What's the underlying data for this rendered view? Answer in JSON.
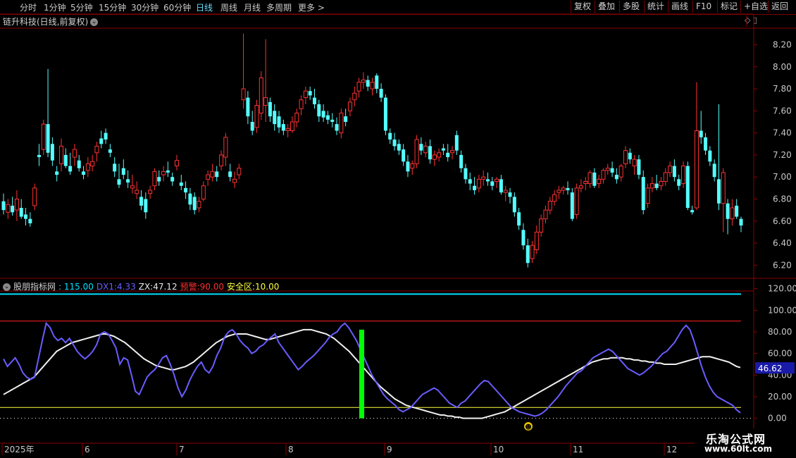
{
  "toolbar": {
    "timeframes": [
      "分时",
      "1分钟",
      "5分钟",
      "15分钟",
      "30分钟",
      "60分钟",
      "日线",
      "周线",
      "月线",
      "多周期",
      "更多 >"
    ],
    "active": "日线",
    "right_buttons": [
      "复权",
      "叠加",
      "多股",
      "统计",
      "画线",
      "F10",
      "标记",
      "+自选",
      "返回"
    ]
  },
  "stock": {
    "title": "链升科技(日线,前复权)"
  },
  "price_axis": {
    "labels": [
      "8.20",
      "8.00",
      "7.80",
      "7.60",
      "7.40",
      "7.20",
      "7.00",
      "6.80",
      "6.60",
      "6.40",
      "6.20"
    ],
    "values": [
      8.2,
      8.0,
      7.8,
      7.6,
      7.4,
      7.2,
      7.0,
      6.8,
      6.6,
      6.4,
      6.2
    ]
  },
  "indicator": {
    "name": "股朋指标网",
    "fields": [
      {
        "label": "",
        "value": ": 115.00",
        "color": "#00e0ff"
      },
      {
        "label": "DX1:",
        "value": "4.33",
        "color": "#6a5cff"
      },
      {
        "label": "ZX:",
        "value": "47.12",
        "color": "#e8e8e8"
      },
      {
        "label": "预警:",
        "value": "90.00",
        "color": "#ff3030"
      },
      {
        "label": "安全区:",
        "value": "10.00",
        "color": "#ffff40"
      }
    ],
    "axis_labels": [
      "120.00",
      "100.00",
      "80.00",
      "60.00",
      "40.00",
      "20.00",
      "0.00"
    ],
    "axis_values": [
      120,
      100,
      80,
      60,
      40,
      20,
      0
    ],
    "current_value": "46.62",
    "lines": {
      "top": 115,
      "warn": 90,
      "safe": 10
    },
    "colors": {
      "top": "#00e0ff",
      "warn": "#ff2020",
      "safe": "#ffff40",
      "dx1": "#6a5cff",
      "zx": "#f0f0f0",
      "signal": "#00ff00"
    }
  },
  "time_axis": {
    "labels": [
      "2025年",
      "6",
      "7",
      "8",
      "9",
      "10",
      "11",
      "12"
    ]
  },
  "watermark": {
    "line1": "乐淘公式网",
    "line2": "www.60lt.com"
  },
  "chart_data": {
    "type": "candlestick",
    "ylim": [
      6.1,
      8.35
    ],
    "candles": [
      [
        6.78,
        6.85,
        6.66,
        6.7
      ],
      [
        6.68,
        6.8,
        6.62,
        6.75
      ],
      [
        6.74,
        6.82,
        6.65,
        6.68
      ],
      [
        6.7,
        6.88,
        6.6,
        6.8
      ],
      [
        6.72,
        6.8,
        6.62,
        6.64
      ],
      [
        6.66,
        6.72,
        6.56,
        6.62
      ],
      [
        6.62,
        6.68,
        6.55,
        6.58
      ],
      [
        6.74,
        6.94,
        6.7,
        6.9
      ],
      [
        7.2,
        7.3,
        7.1,
        7.18
      ],
      [
        7.25,
        7.52,
        7.2,
        7.48
      ],
      [
        7.48,
        7.98,
        7.18,
        7.22
      ],
      [
        7.3,
        7.36,
        7.1,
        7.15
      ],
      [
        7.05,
        7.1,
        6.96,
        7.02
      ],
      [
        7.12,
        7.35,
        7.05,
        7.28
      ],
      [
        7.2,
        7.26,
        7.08,
        7.1
      ],
      [
        7.1,
        7.22,
        7.02,
        7.05
      ],
      [
        7.18,
        7.3,
        7.1,
        7.25
      ],
      [
        7.15,
        7.2,
        7.05,
        7.08
      ],
      [
        7.05,
        7.1,
        6.98,
        7.02
      ],
      [
        7.06,
        7.18,
        7.0,
        7.12
      ],
      [
        7.1,
        7.2,
        7.05,
        7.14
      ],
      [
        7.22,
        7.32,
        7.14,
        7.28
      ],
      [
        7.35,
        7.42,
        7.26,
        7.3
      ],
      [
        7.4,
        7.44,
        7.3,
        7.34
      ],
      [
        7.25,
        7.3,
        7.18,
        7.22
      ],
      [
        7.12,
        7.18,
        7.0,
        7.05
      ],
      [
        6.98,
        7.12,
        6.9,
        6.93
      ],
      [
        7.08,
        7.16,
        6.98,
        7.02
      ],
      [
        6.98,
        7.06,
        6.9,
        6.95
      ],
      [
        6.9,
        7.02,
        6.85,
        6.92
      ],
      [
        6.85,
        6.96,
        6.8,
        6.88
      ],
      [
        6.82,
        6.88,
        6.7,
        6.74
      ],
      [
        6.8,
        6.86,
        6.62,
        6.68
      ],
      [
        6.85,
        6.92,
        6.8,
        6.88
      ],
      [
        6.92,
        7.08,
        6.88,
        7.05
      ],
      [
        7.0,
        7.06,
        6.92,
        6.96
      ],
      [
        7.02,
        7.1,
        6.96,
        7.05
      ],
      [
        7.06,
        7.14,
        7.0,
        7.04
      ],
      [
        7.0,
        7.04,
        6.92,
        6.96
      ],
      [
        7.1,
        7.2,
        7.06,
        7.15
      ],
      [
        6.95,
        7.02,
        6.88,
        6.92
      ],
      [
        6.9,
        6.96,
        6.8,
        6.86
      ],
      [
        6.85,
        6.9,
        6.7,
        6.75
      ],
      [
        6.82,
        6.86,
        6.66,
        6.7
      ],
      [
        6.72,
        6.82,
        6.68,
        6.78
      ],
      [
        6.8,
        6.96,
        6.78,
        6.92
      ],
      [
        6.98,
        7.06,
        6.92,
        7.02
      ],
      [
        7.0,
        7.12,
        6.96,
        7.05
      ],
      [
        7.05,
        7.1,
        6.96,
        7.0
      ],
      [
        7.1,
        7.24,
        7.06,
        7.2
      ],
      [
        7.18,
        7.4,
        7.1,
        7.36
      ],
      [
        7.05,
        7.12,
        6.96,
        7.0
      ],
      [
        6.95,
        7.05,
        6.9,
        6.98
      ],
      [
        7.02,
        7.12,
        6.98,
        7.08
      ],
      [
        7.7,
        8.3,
        7.62,
        7.8
      ],
      [
        7.72,
        7.78,
        7.48,
        7.55
      ],
      [
        7.5,
        7.6,
        7.38,
        7.42
      ],
      [
        7.45,
        7.7,
        7.4,
        7.65
      ],
      [
        7.58,
        7.96,
        7.52,
        7.9
      ],
      [
        7.65,
        8.25,
        7.5,
        7.72
      ],
      [
        7.68,
        7.72,
        7.5,
        7.55
      ],
      [
        7.6,
        7.66,
        7.42,
        7.48
      ],
      [
        7.55,
        7.6,
        7.4,
        7.45
      ],
      [
        7.48,
        7.52,
        7.38,
        7.42
      ],
      [
        7.42,
        7.48,
        7.36,
        7.44
      ],
      [
        7.42,
        7.55,
        7.4,
        7.5
      ],
      [
        7.5,
        7.62,
        7.45,
        7.58
      ],
      [
        7.62,
        7.74,
        7.56,
        7.7
      ],
      [
        7.72,
        7.82,
        7.66,
        7.78
      ],
      [
        7.78,
        7.82,
        7.7,
        7.74
      ],
      [
        7.72,
        7.8,
        7.62,
        7.66
      ],
      [
        7.66,
        7.7,
        7.5,
        7.55
      ],
      [
        7.6,
        7.66,
        7.5,
        7.54
      ],
      [
        7.56,
        7.6,
        7.48,
        7.52
      ],
      [
        7.52,
        7.58,
        7.45,
        7.5
      ],
      [
        7.48,
        7.54,
        7.38,
        7.42
      ],
      [
        7.4,
        7.62,
        7.35,
        7.58
      ],
      [
        7.55,
        7.62,
        7.46,
        7.5
      ],
      [
        7.6,
        7.72,
        7.55,
        7.68
      ],
      [
        7.7,
        7.82,
        7.64,
        7.76
      ],
      [
        7.78,
        7.9,
        7.72,
        7.86
      ],
      [
        7.86,
        7.95,
        7.8,
        7.88
      ],
      [
        7.88,
        7.92,
        7.78,
        7.82
      ],
      [
        7.8,
        7.9,
        7.74,
        7.86
      ],
      [
        7.92,
        7.94,
        7.76,
        7.8
      ],
      [
        7.8,
        7.85,
        7.68,
        7.72
      ],
      [
        7.72,
        7.75,
        7.38,
        7.42
      ],
      [
        7.4,
        7.44,
        7.3,
        7.34
      ],
      [
        7.34,
        7.4,
        7.24,
        7.28
      ],
      [
        7.3,
        7.34,
        7.2,
        7.24
      ],
      [
        7.25,
        7.3,
        7.1,
        7.14
      ],
      [
        7.14,
        7.2,
        7.0,
        7.05
      ],
      [
        7.08,
        7.15,
        7.02,
        7.12
      ],
      [
        7.12,
        7.38,
        7.08,
        7.34
      ],
      [
        7.3,
        7.36,
        7.2,
        7.24
      ],
      [
        7.22,
        7.32,
        7.18,
        7.28
      ],
      [
        7.28,
        7.34,
        7.12,
        7.16
      ],
      [
        7.16,
        7.24,
        7.1,
        7.2
      ],
      [
        7.18,
        7.26,
        7.14,
        7.22
      ],
      [
        7.26,
        7.3,
        7.2,
        7.24
      ],
      [
        7.22,
        7.3,
        7.14,
        7.18
      ],
      [
        7.22,
        7.28,
        7.16,
        7.24
      ],
      [
        7.38,
        7.42,
        7.2,
        7.24
      ],
      [
        7.2,
        7.24,
        7.04,
        7.08
      ],
      [
        7.08,
        7.12,
        6.94,
        6.98
      ],
      [
        6.98,
        7.04,
        6.88,
        6.94
      ],
      [
        6.92,
        7.0,
        6.84,
        6.88
      ],
      [
        6.9,
        7.02,
        6.86,
        6.98
      ],
      [
        6.98,
        7.06,
        6.92,
        7.0
      ],
      [
        6.98,
        7.04,
        6.92,
        6.96
      ],
      [
        6.96,
        7.0,
        6.88,
        6.92
      ],
      [
        6.96,
        7.0,
        6.9,
        6.98
      ],
      [
        6.98,
        7.02,
        6.84,
        6.86
      ],
      [
        6.86,
        6.92,
        6.78,
        6.88
      ],
      [
        6.86,
        6.9,
        6.76,
        6.82
      ],
      [
        6.82,
        6.86,
        6.64,
        6.68
      ],
      [
        6.68,
        6.72,
        6.52,
        6.56
      ],
      [
        6.52,
        6.58,
        6.34,
        6.38
      ],
      [
        6.38,
        6.44,
        6.18,
        6.22
      ],
      [
        6.26,
        6.42,
        6.22,
        6.38
      ],
      [
        6.34,
        6.56,
        6.3,
        6.5
      ],
      [
        6.5,
        6.66,
        6.46,
        6.62
      ],
      [
        6.62,
        6.74,
        6.58,
        6.7
      ],
      [
        6.7,
        6.82,
        6.66,
        6.78
      ],
      [
        6.78,
        6.88,
        6.74,
        6.84
      ],
      [
        6.86,
        6.92,
        6.8,
        6.88
      ],
      [
        6.88,
        6.92,
        6.84,
        6.9
      ],
      [
        6.9,
        6.96,
        6.84,
        6.88
      ],
      [
        6.86,
        6.9,
        6.6,
        6.62
      ],
      [
        6.66,
        6.94,
        6.62,
        6.9
      ],
      [
        6.9,
        6.98,
        6.86,
        6.92
      ],
      [
        6.94,
        7.0,
        6.88,
        6.96
      ],
      [
        6.94,
        7.06,
        6.9,
        7.04
      ],
      [
        7.04,
        7.08,
        6.9,
        6.92
      ],
      [
        6.94,
        7.02,
        6.9,
        6.98
      ],
      [
        6.98,
        7.08,
        6.94,
        7.06
      ],
      [
        7.06,
        7.12,
        7.02,
        7.08
      ],
      [
        7.08,
        7.14,
        7.0,
        7.04
      ],
      [
        7.02,
        7.08,
        6.94,
        6.98
      ],
      [
        7.0,
        7.12,
        6.96,
        7.1
      ],
      [
        7.12,
        7.28,
        7.08,
        7.24
      ],
      [
        7.22,
        7.26,
        7.12,
        7.16
      ],
      [
        7.1,
        7.2,
        7.02,
        7.16
      ],
      [
        7.16,
        7.2,
        6.98,
        7.02
      ],
      [
        7.0,
        7.06,
        6.66,
        6.7
      ],
      [
        6.76,
        6.94,
        6.72,
        6.9
      ],
      [
        6.9,
        7.0,
        6.86,
        6.94
      ],
      [
        6.94,
        7.02,
        6.88,
        6.9
      ],
      [
        6.92,
        7.0,
        6.88,
        6.96
      ],
      [
        6.96,
        7.08,
        6.92,
        7.04
      ],
      [
        7.04,
        7.14,
        7.0,
        7.1
      ],
      [
        7.1,
        7.16,
        6.96,
        7.0
      ],
      [
        6.98,
        7.02,
        6.88,
        6.92
      ],
      [
        6.94,
        7.14,
        6.9,
        7.1
      ],
      [
        7.1,
        7.14,
        6.7,
        6.72
      ],
      [
        6.7,
        6.74,
        6.66,
        6.68
      ],
      [
        6.72,
        7.86,
        6.7,
        7.42
      ],
      [
        7.42,
        7.6,
        7.3,
        7.36
      ],
      [
        7.36,
        7.4,
        7.2,
        7.24
      ],
      [
        7.24,
        7.28,
        7.1,
        7.14
      ],
      [
        7.12,
        7.16,
        6.96,
        7.0
      ],
      [
        6.98,
        7.66,
        6.7,
        6.76
      ],
      [
        6.76,
        7.08,
        6.5,
        7.04
      ],
      [
        6.76,
        6.8,
        6.48,
        6.62
      ],
      [
        6.62,
        6.8,
        6.56,
        6.72
      ],
      [
        6.74,
        6.8,
        6.62,
        6.64
      ],
      [
        6.62,
        6.64,
        6.5,
        6.56
      ]
    ],
    "dx1": [
      55,
      48,
      52,
      56,
      50,
      42,
      38,
      36,
      38,
      55,
      72,
      88,
      84,
      76,
      72,
      74,
      70,
      74,
      68,
      62,
      58,
      55,
      58,
      62,
      68,
      78,
      80,
      78,
      72,
      65,
      50,
      56,
      54,
      40,
      25,
      22,
      30,
      38,
      42,
      45,
      50,
      56,
      58,
      50,
      40,
      28,
      20,
      26,
      35,
      42,
      48,
      52,
      45,
      42,
      48,
      58,
      65,
      75,
      80,
      82,
      78,
      72,
      68,
      65,
      60,
      62,
      66,
      68,
      72,
      75,
      78,
      70,
      65,
      60,
      55,
      50,
      45,
      48,
      52,
      55,
      58,
      62,
      66,
      70,
      75,
      78,
      80,
      85,
      88,
      84,
      78,
      72,
      64,
      56,
      48,
      40,
      34,
      28,
      22,
      18,
      15,
      12,
      8,
      6,
      8,
      10,
      14,
      18,
      22,
      24,
      26,
      28,
      26,
      22,
      18,
      14,
      12,
      10,
      14,
      16,
      20,
      24,
      28,
      32,
      35,
      34,
      30,
      26,
      22,
      18,
      14,
      10,
      8,
      6,
      5,
      4,
      3,
      2,
      3,
      5,
      8,
      12,
      16,
      20,
      25,
      30,
      34,
      38,
      42,
      44,
      48,
      52,
      56,
      58,
      60,
      62,
      64,
      62,
      58,
      54,
      50,
      46,
      44,
      42,
      40,
      42,
      45,
      48,
      52,
      56,
      60,
      62,
      66,
      70,
      76,
      82,
      86,
      82,
      72,
      60,
      48,
      38,
      30,
      24,
      20,
      18,
      16,
      14,
      12,
      8,
      5
    ],
    "zx": [
      22,
      24,
      26,
      28,
      30,
      32,
      34,
      36,
      38,
      42,
      46,
      50,
      54,
      58,
      62,
      64,
      66,
      68,
      70,
      71,
      72,
      73,
      74,
      75,
      76,
      77,
      78,
      78,
      77,
      76,
      74,
      72,
      70,
      67,
      64,
      61,
      58,
      55,
      53,
      51,
      49,
      48,
      47,
      46,
      45,
      45,
      46,
      47,
      48,
      50,
      52,
      55,
      58,
      61,
      64,
      67,
      70,
      72,
      74,
      76,
      77,
      78,
      78,
      78,
      78,
      77,
      76,
      75,
      74,
      73,
      73,
      74,
      75,
      76,
      77,
      78,
      79,
      80,
      81,
      82,
      82,
      82,
      81,
      80,
      79,
      78,
      76,
      74,
      71,
      68,
      65,
      62,
      58,
      54,
      50,
      46,
      42,
      38,
      34,
      30,
      27,
      24,
      21,
      18,
      16,
      14,
      12,
      11,
      10,
      9,
      8,
      7,
      6,
      5,
      4,
      3,
      3,
      2,
      2,
      1,
      1,
      0,
      0,
      0,
      0,
      0,
      0,
      1,
      2,
      3,
      4,
      5,
      6,
      8,
      10,
      12,
      14,
      16,
      18,
      20,
      22,
      24,
      26,
      28,
      30,
      32,
      34,
      36,
      38,
      40,
      42,
      44,
      46,
      48,
      50,
      52,
      53,
      54,
      55,
      55,
      56,
      56,
      56,
      56,
      55,
      55,
      54,
      54,
      53,
      53,
      52,
      52,
      51,
      51,
      50,
      50,
      50,
      50,
      51,
      52,
      53,
      54,
      55,
      56,
      57,
      57,
      57,
      56,
      55,
      54,
      53,
      52,
      50,
      48,
      47
    ]
  }
}
